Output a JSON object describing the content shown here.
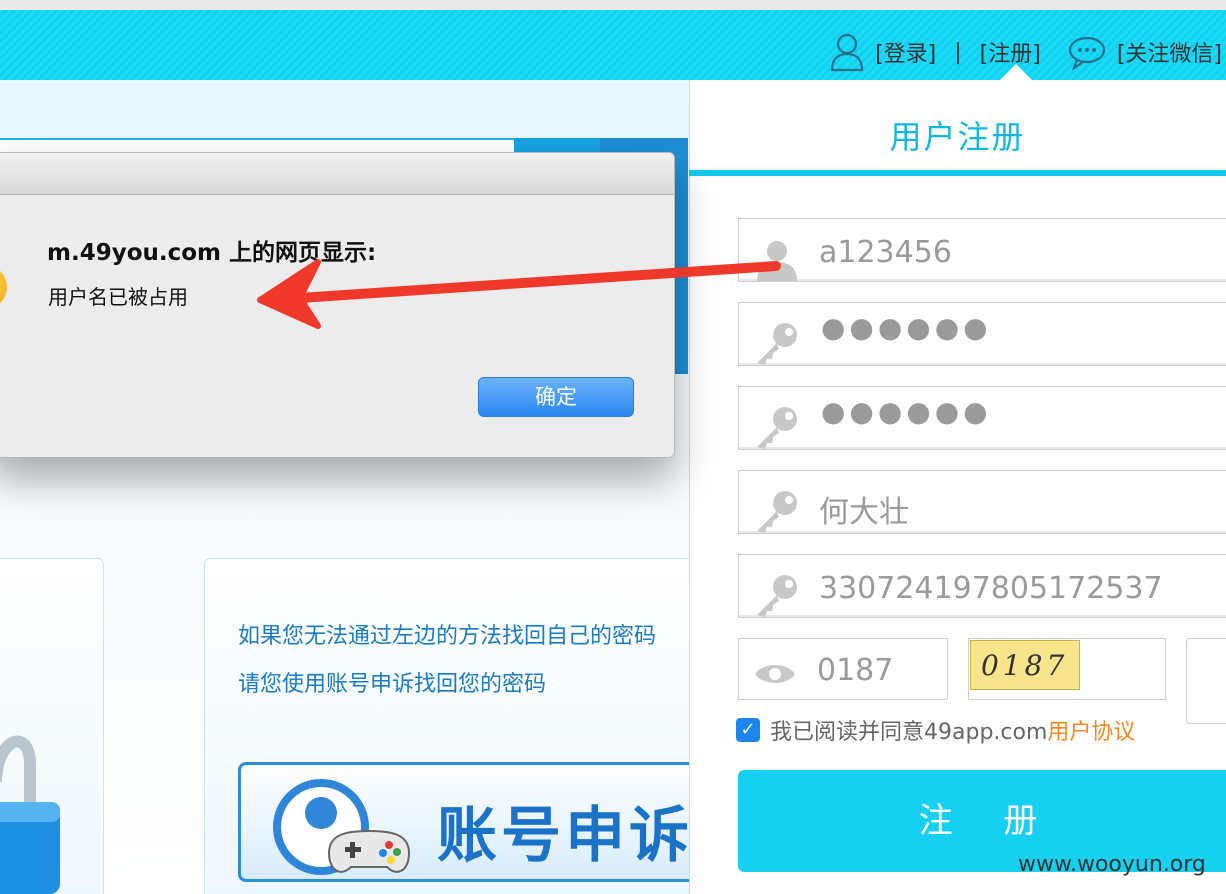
{
  "topbar": {
    "login": "[登录]",
    "separator": "|",
    "register": "[注册]",
    "wechat": "[关注微信]"
  },
  "background": {
    "help_text_line1": "如果您无法通过左边的方法找回自己的密码",
    "help_text_line2": "请您使用账号申诉找回您的密码",
    "appeal_button": "账号申诉"
  },
  "dialog": {
    "title": "m.49you.com 上的网页显示:",
    "message": "用户名已被占用",
    "ok_button": "确定"
  },
  "register_panel": {
    "title": "用户注册",
    "fields": [
      {
        "icon": "user-icon",
        "value": "a123456"
      },
      {
        "icon": "key-icon",
        "value": "●●●●●●"
      },
      {
        "icon": "key-icon",
        "value": "●●●●●●"
      },
      {
        "icon": "key-icon",
        "value": "何大壮"
      },
      {
        "icon": "key-icon",
        "value": "330724197805172537"
      }
    ],
    "captcha_value": "0187",
    "captcha_image_code": "0187",
    "agree_text": "我已阅读并同意49app.com",
    "agree_link": "用户协议",
    "submit": "注 册"
  },
  "watermark": "www.wooyun.org",
  "colors": {
    "accent": "#0fd6f6",
    "panel_title": "#11b7e0",
    "link": "#f08a1c",
    "arrow": "#f0392b",
    "dialog_button": "#2a86f0"
  }
}
